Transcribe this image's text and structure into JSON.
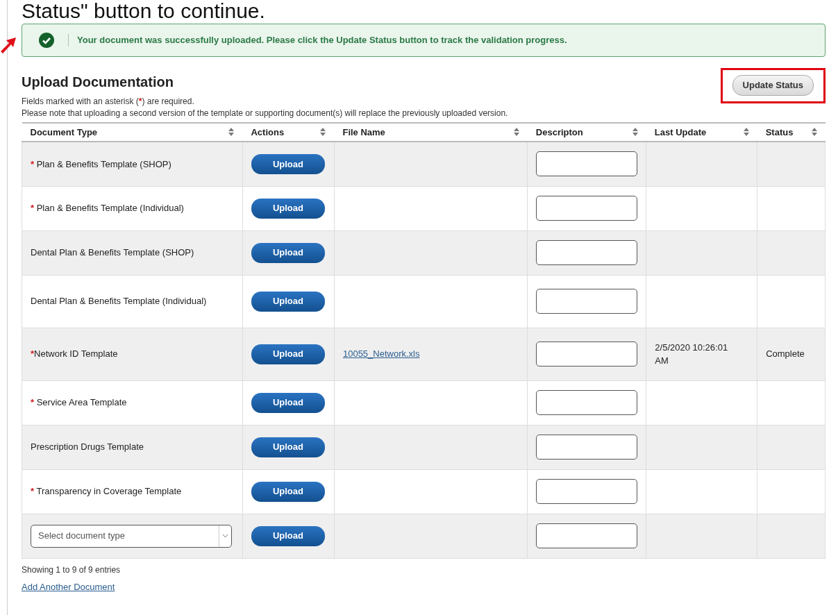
{
  "instruction_tail": "Status\" button to continue.",
  "alert": {
    "message": "Your document was successfully uploaded. Please click the Update Status button to track the validation progress."
  },
  "section": {
    "title": "Upload Documentation",
    "required_note": {
      "before": "Fields marked with an asterisk (",
      "mark": "*",
      "after": ") are required."
    },
    "note": "Please note that uploading a second version of the template or supporting document(s) will replace the previously uploaded version.",
    "update_button": "Update Status",
    "update_highlighted": true
  },
  "table": {
    "columns": [
      "Document Type",
      "Actions",
      "File Name",
      "Descripton",
      "Last Update",
      "Status"
    ],
    "rows": [
      {
        "kind": "text",
        "required_mark": "*",
        "document_type": "Plan & Benefits Template (SHOP)",
        "action": "Upload"
      },
      {
        "kind": "text",
        "required_mark": "*",
        "document_type": "Plan & Benefits Template (Individual)",
        "action": "Upload"
      },
      {
        "kind": "text",
        "document_type": "Dental Plan & Benefits Template (SHOP)",
        "action": "Upload"
      },
      {
        "kind": "text",
        "document_type": "Dental Plan & Benefits Template (Individual)",
        "action": "Upload"
      },
      {
        "kind": "text",
        "required_mark": "*",
        "document_type": "Network ID Template",
        "action": "Upload",
        "file_name": "10055_Network.xls",
        "last_update": "2/5/2020 10:26:01 AM",
        "status": "Complete"
      },
      {
        "kind": "text",
        "required_mark": "*",
        "document_type": "Service Area Template",
        "action": "Upload"
      },
      {
        "kind": "text",
        "document_type": "Prescription Drugs Template",
        "action": "Upload"
      },
      {
        "kind": "text",
        "required_mark": "*",
        "document_type": "Transparency in Coverage Template",
        "action": "Upload"
      },
      {
        "kind": "select",
        "placeholder": "Select document type",
        "action": "Upload"
      }
    ]
  },
  "summary": "Showing 1 to 9 of 9 entries",
  "add_link": "Add Another Document"
}
